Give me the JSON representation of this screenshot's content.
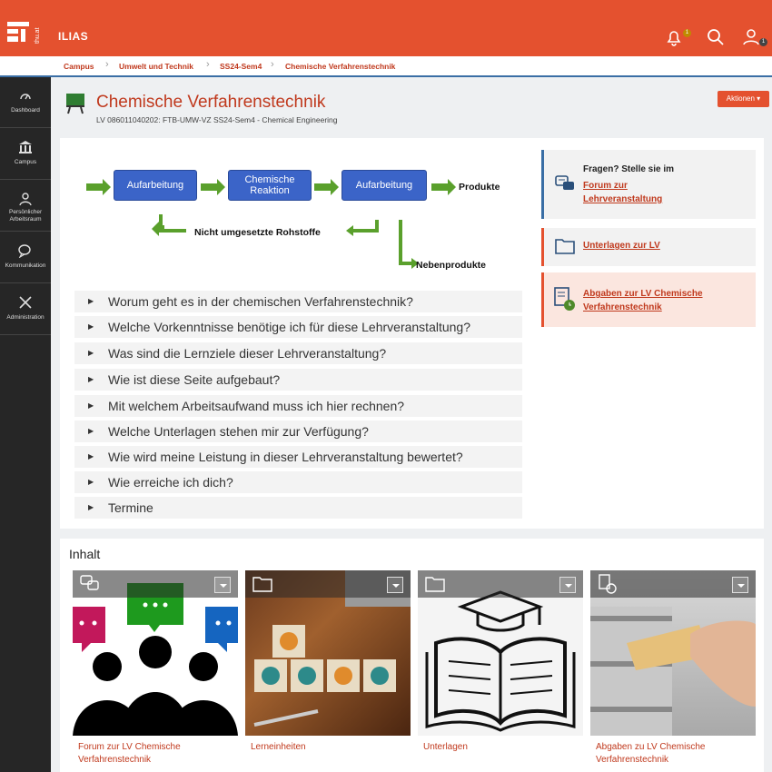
{
  "app": {
    "name": "ILIAS",
    "logo_text": "thu.at",
    "notif_count": "1",
    "user_count": "1"
  },
  "breadcrumb": [
    "Campus",
    "Umwelt und Technik",
    "SS24-Sem4",
    "Chemische Verfahrenstechnik"
  ],
  "sidebar": [
    {
      "label": "Dashboard",
      "icon": "dashboard-icon"
    },
    {
      "label": "Campus",
      "icon": "campus-icon"
    },
    {
      "label": "Persönlicher Arbeitsraum",
      "icon": "user-icon"
    },
    {
      "label": "Kommunikation",
      "icon": "chat-icon"
    },
    {
      "label": "Administration",
      "icon": "tools-icon"
    }
  ],
  "page": {
    "title": "Chemische Verfahrenstechnik",
    "subtitle": "LV 086011040202: FTB-UMW-VZ SS24-Sem4 - Chemical Engineering",
    "actions_label": "Aktionen"
  },
  "diagram": {
    "box1": "Aufarbeitung",
    "box2": "Chemische Reaktion",
    "box3": "Aufarbeitung",
    "products": "Produkte",
    "recycle": "Nicht umgesetzte Rohstoffe",
    "byproducts": "Nebenprodukte"
  },
  "accordion": [
    "Worum geht es in der chemischen Verfahrenstechnik?",
    "Welche Vorkenntnisse benötige ich für diese Lehrveranstaltung?",
    "Was sind die Lernziele dieser Lehrveranstaltung?",
    "Wie ist diese Seite aufgebaut?",
    "Mit welchem Arbeitsaufwand muss ich hier rechnen?",
    "Welche Unterlagen stehen mir zur Verfügung?",
    "Wie wird meine Leistung in dieser Lehrveranstaltung bewertet?",
    "Wie erreiche ich dich?",
    "Termine"
  ],
  "cards": {
    "forum_intro": "Fragen? Stelle sie im",
    "forum_link": "Forum zur Lehrveranstaltung",
    "unterlagen_link": "Unterlagen zur LV",
    "abgaben_link": "Abgaben zur LV Chemische Verfahrenstechnik"
  },
  "content": {
    "heading": "Inhalt",
    "tiles": [
      "Forum zur LV Chemische Verfahrenstechnik",
      "Lerneinheiten",
      "Unterlagen",
      "Abgaben zu LV Chemische Verfahrenstechnik"
    ]
  },
  "colors": {
    "brand": "#e4512f",
    "link": "#c0391d",
    "box": "#3b64c8",
    "arrow": "#5aa02c"
  }
}
